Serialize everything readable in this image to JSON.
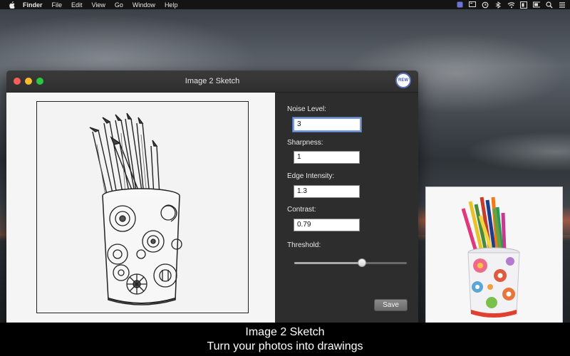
{
  "menubar": {
    "app_name": "Finder",
    "items": [
      "File",
      "Edit",
      "View",
      "Go",
      "Window",
      "Help"
    ],
    "status_icons": [
      "notification-badge-icon",
      "display-icon",
      "time-machine-icon",
      "bluetooth-icon",
      "wifi-icon",
      "input-source-icon",
      "battery-icon",
      "spotlight-icon",
      "notification-center-icon"
    ]
  },
  "window": {
    "title": "Image 2 Sketch",
    "badge": "REW"
  },
  "controls": {
    "noise_label": "Noise Level:",
    "noise_value": "3",
    "sharpness_label": "Sharpness:",
    "sharpness_value": "1",
    "edge_label": "Edge Intensity:",
    "edge_value": "1.3",
    "contrast_label": "Contrast:",
    "contrast_value": "0.79",
    "threshold_label": "Threshold:",
    "threshold_fraction": 0.6,
    "save_label": "Save"
  },
  "caption": {
    "line1": "Image 2 Sketch",
    "line2": "Turn your photos into drawings"
  },
  "colors": {
    "close": "#fc5f57",
    "minimize": "#fdbc2e",
    "zoom": "#28c840",
    "focus_ring": "#7b9ad6"
  }
}
